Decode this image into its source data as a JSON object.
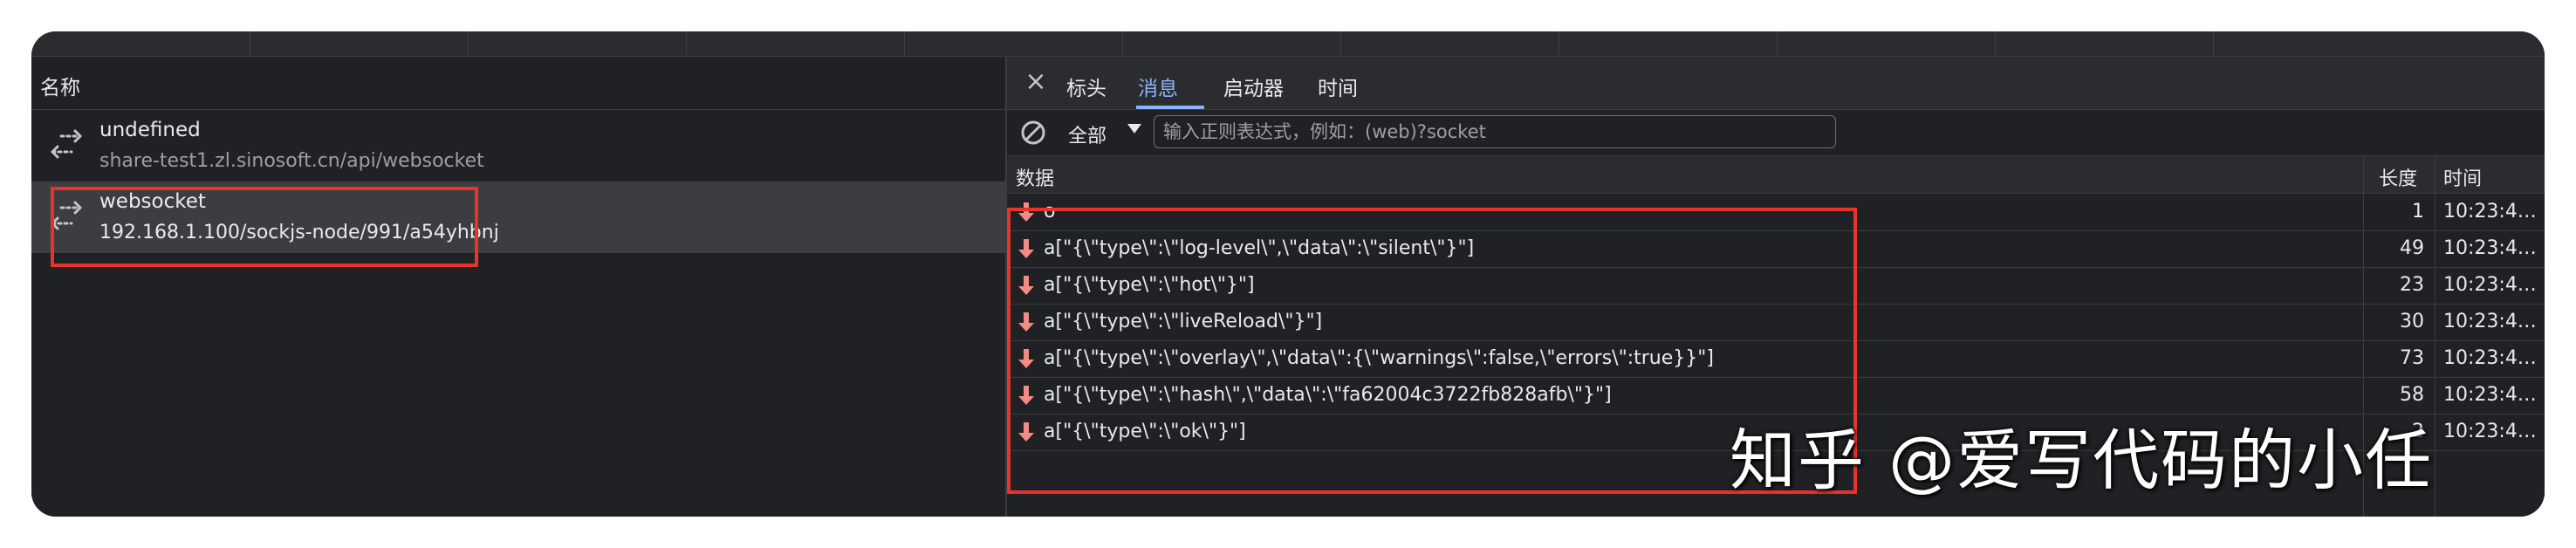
{
  "left_panel": {
    "column_header": "名称",
    "requests": [
      {
        "name": "undefined",
        "url": "share-test1.zl.sinosoft.cn/api/websocket",
        "selected": false
      },
      {
        "name": "websocket",
        "url": "192.168.1.100/sockjs-node/991/a54yhbnj",
        "selected": true
      }
    ]
  },
  "detail_panel": {
    "tabs": [
      {
        "label": "标头",
        "active": false
      },
      {
        "label": "消息",
        "active": true
      },
      {
        "label": "启动器",
        "active": false
      },
      {
        "label": "时间",
        "active": false
      }
    ],
    "filter": {
      "type_select": "全部",
      "placeholder": "输入正则表达式，例如：(web)?socket",
      "value": ""
    },
    "grid": {
      "headers": {
        "data": "数据",
        "length": "长度",
        "time": "时间"
      },
      "rows": [
        {
          "data": "o",
          "length": "1",
          "time": "10:23:4…",
          "direction": "received"
        },
        {
          "data": "a[\"{\\\"type\\\":\\\"log-level\\\",\\\"data\\\":\\\"silent\\\"}\"]",
          "length": "49",
          "time": "10:23:4…",
          "direction": "received"
        },
        {
          "data": "a[\"{\\\"type\\\":\\\"hot\\\"}\"]",
          "length": "23",
          "time": "10:23:4…",
          "direction": "received"
        },
        {
          "data": "a[\"{\\\"type\\\":\\\"liveReload\\\"}\"]",
          "length": "30",
          "time": "10:23:4…",
          "direction": "received"
        },
        {
          "data": "a[\"{\\\"type\\\":\\\"overlay\\\",\\\"data\\\":{\\\"warnings\\\":false,\\\"errors\\\":true}}\"]",
          "length": "73",
          "time": "10:23:4…",
          "direction": "received"
        },
        {
          "data": "a[\"{\\\"type\\\":\\\"hash\\\",\\\"data\\\":\\\"fa62004c3722fb828afb\\\"}\"]",
          "length": "58",
          "time": "10:23:4…",
          "direction": "received"
        },
        {
          "data": "a[\"{\\\"type\\\":\\\"ok\\\"}\"]",
          "length": "2",
          "time": "10:23:4…",
          "direction": "received"
        }
      ]
    }
  },
  "watermark": "知乎 @爱写代码的小任",
  "colors": {
    "panel_bg": "#202124",
    "selected_row": "#3b3d42",
    "active_tab": "#8ab4f8",
    "received_arrow": "#f28b82",
    "annotation_red": "#e8322a"
  },
  "icons": {
    "request_type": "websocket-arrows-icon",
    "close": "close-icon",
    "clear": "block-icon",
    "filter_dropdown": "caret-down-icon",
    "message": "arrow-down-icon"
  }
}
